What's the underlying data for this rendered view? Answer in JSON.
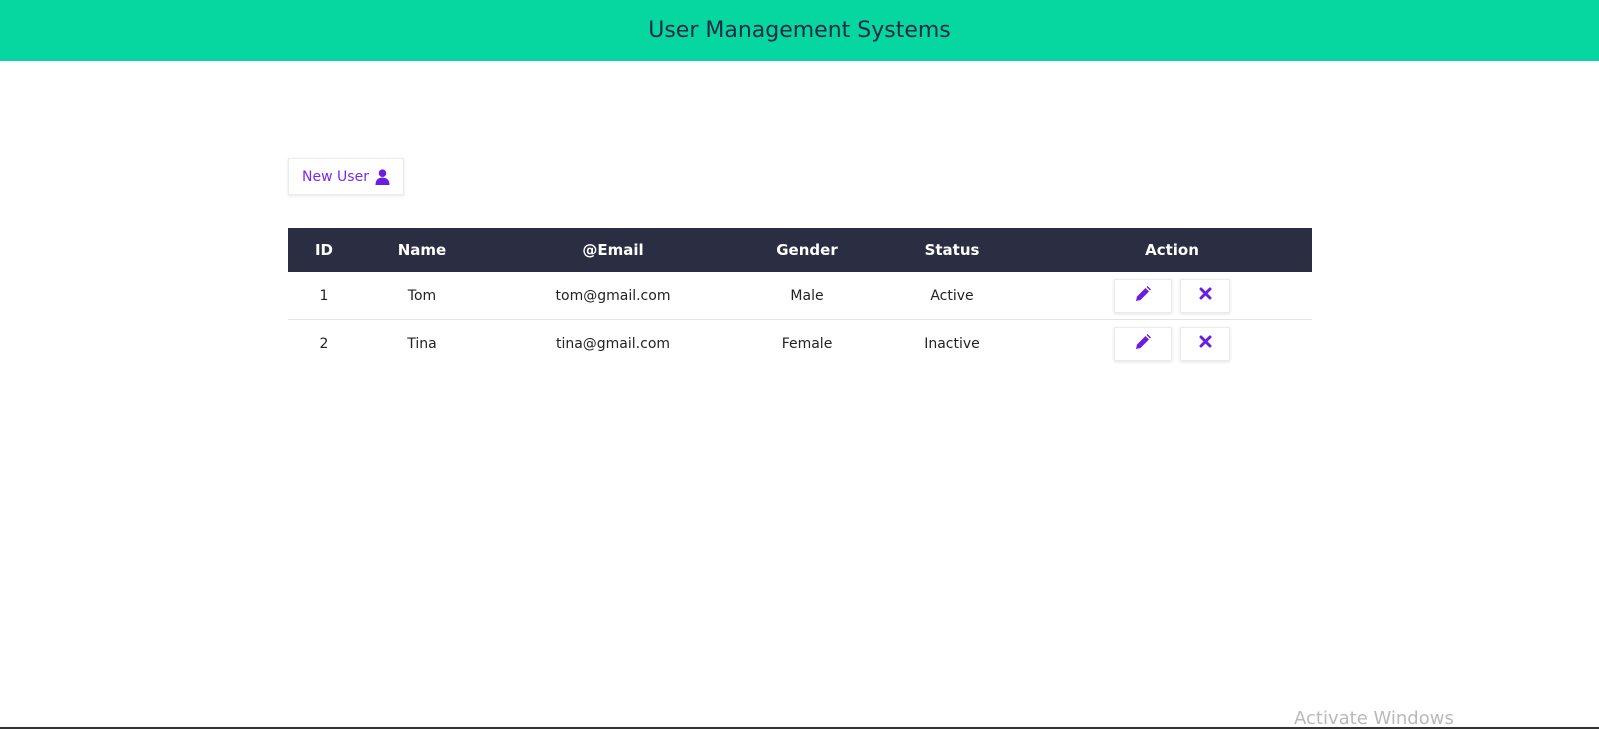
{
  "header": {
    "title": "User Management Systems",
    "background_color": "#06d6a0"
  },
  "toolbar": {
    "new_user_label": "New User",
    "new_user_icon": "user-icon",
    "accent_color": "#7a2be6"
  },
  "table": {
    "header_background": "#2b2d42",
    "columns": [
      "ID",
      "Name",
      "@Email",
      "Gender",
      "Status",
      "Action"
    ],
    "rows": [
      {
        "id": "1",
        "name": "Tom",
        "email": "tom@gmail.com",
        "gender": "Male",
        "status": "Active",
        "actions": [
          "pencil-icon",
          "close-icon"
        ]
      },
      {
        "id": "2",
        "name": "Tina",
        "email": "tina@gmail.com",
        "gender": "Female",
        "status": "Inactive",
        "actions": [
          "pencil-icon",
          "close-icon"
        ]
      }
    ]
  },
  "watermark": "Activate Windows"
}
